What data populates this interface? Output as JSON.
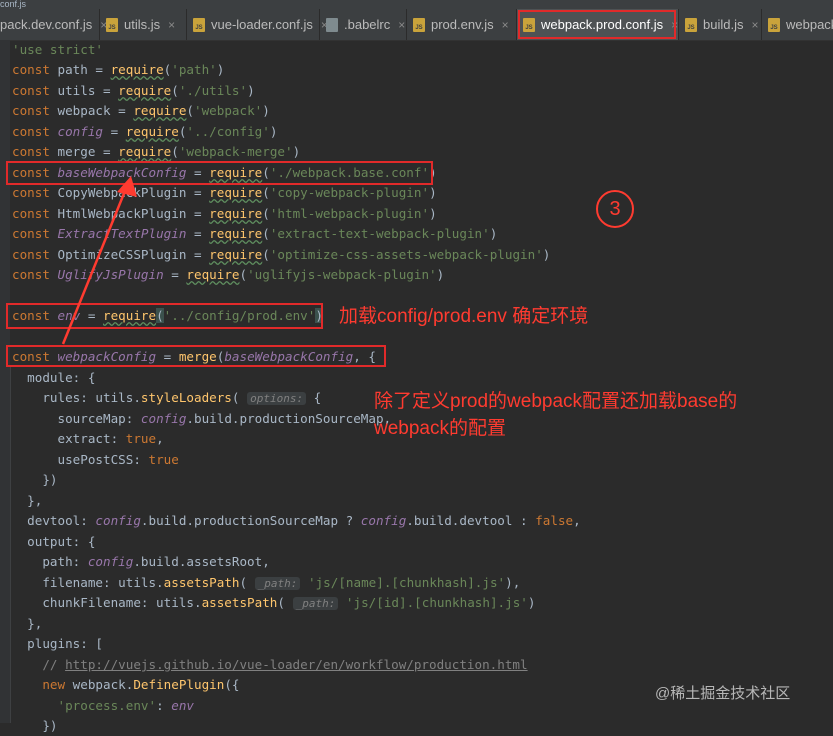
{
  "breadcrumb": "conf.js",
  "tabs": [
    {
      "label": "pack.dev.conf.js",
      "active": false
    },
    {
      "label": "utils.js",
      "active": false
    },
    {
      "label": "vue-loader.conf.js",
      "active": false
    },
    {
      "label": ".babelrc",
      "active": false
    },
    {
      "label": "prod.env.js",
      "active": false
    },
    {
      "label": "webpack.prod.conf.js",
      "active": true
    },
    {
      "label": "build.js",
      "active": false
    },
    {
      "label": "webpack",
      "active": false
    }
  ],
  "code": {
    "l1": {
      "s": "'use strict'"
    },
    "l2": {
      "kw": "const ",
      "id": "path",
      "eq": " = ",
      "fn": "require",
      "p1": "(",
      "s": "'path'",
      "p2": ")"
    },
    "l3": {
      "kw": "const ",
      "id": "utils",
      "eq": " = ",
      "fn": "require",
      "p1": "(",
      "s": "'./utils'",
      "p2": ")"
    },
    "l4": {
      "kw": "const ",
      "id": "webpack",
      "eq": " = ",
      "fn": "require",
      "p1": "(",
      "s": "'webpack'",
      "p2": ")"
    },
    "l5": {
      "kw": "const ",
      "id": "config",
      "eq": " = ",
      "fn": "require",
      "p1": "(",
      "s": "'../config'",
      "p2": ")"
    },
    "l6": {
      "kw": "const ",
      "id": "merge",
      "eq": " = ",
      "fn": "require",
      "p1": "(",
      "s": "'webpack-merge'",
      "p2": ")"
    },
    "l7": {
      "kw": "const ",
      "id": "baseWebpackConfig",
      "eq": " = ",
      "fn": "require",
      "p1": "(",
      "s": "'./webpack.base.conf'",
      "p2": ")"
    },
    "l8": {
      "kw": "const ",
      "id": "CopyWebpackPlugin",
      "eq": " = ",
      "fn": "require",
      "p1": "(",
      "s": "'copy-webpack-plugin'",
      "p2": ")"
    },
    "l9": {
      "kw": "const ",
      "id": "HtmlWebpackPlugin",
      "eq": " = ",
      "fn": "require",
      "p1": "(",
      "s": "'html-webpack-plugin'",
      "p2": ")"
    },
    "l10": {
      "kw": "const ",
      "id": "ExtractTextPlugin",
      "eq": " = ",
      "fn": "require",
      "p1": "(",
      "s": "'extract-text-webpack-plugin'",
      "p2": ")"
    },
    "l11": {
      "kw": "const ",
      "id": "OptimizeCSSPlugin",
      "eq": " = ",
      "fn": "require",
      "p1": "(",
      "s": "'optimize-css-assets-webpack-plugin'",
      "p2": ")"
    },
    "l12": {
      "kw": "const ",
      "id": "UglifyJsPlugin",
      "eq": " = ",
      "fn": "require",
      "p1": "(",
      "s": "'uglifyjs-webpack-plugin'",
      "p2": ")"
    },
    "l14": {
      "kw": "const ",
      "id": "env",
      "eq": " = ",
      "fn": "require",
      "p1": "(",
      "s": "'../config/prod.env'",
      "p2": ")"
    },
    "l16": {
      "kw": "const ",
      "id": "webpackConfig",
      "eq": " = ",
      "fn": "merge",
      "p1": "(",
      "arg": "baseWebpackConfig",
      "p2": ", {"
    },
    "l17": {
      "a": "  module: {"
    },
    "l18": {
      "a": "    rules: utils.",
      "fn": "styleLoaders",
      "b": "(",
      "hint": "options:",
      "c": " {"
    },
    "l19": {
      "a": "      sourceMap: ",
      "it": "config",
      "b": ".build.productionSourceMap,"
    },
    "l20": {
      "a": "      extract: ",
      "kw": "true",
      "b": ","
    },
    "l21": {
      "a": "      usePostCSS: ",
      "kw": "true"
    },
    "l22": {
      "a": "    })"
    },
    "l23": {
      "a": "  },"
    },
    "l24": {
      "a": "  devtool: ",
      "it1": "config",
      "b": ".build.productionSourceMap ? ",
      "it2": "config",
      "c": ".build.devtool : ",
      "kw": "false",
      "d": ","
    },
    "l25": {
      "a": "  output: {"
    },
    "l26": {
      "a": "    path: ",
      "it": "config",
      "b": ".build.assetsRoot,"
    },
    "l27": {
      "a": "    filename: utils.",
      "fn": "assetsPath",
      "b": "(",
      "hint": "_path:",
      "s": " 'js/[name].[chunkhash].js'",
      "c": "),"
    },
    "l28": {
      "a": "    chunkFilename: utils.",
      "fn": "assetsPath",
      "b": "(",
      "hint": "_path:",
      "s": " 'js/[id].[chunkhash].js'",
      "c": ")"
    },
    "l29": {
      "a": "  },"
    },
    "l30": {
      "a": "  plugins: ["
    },
    "l31": {
      "c": "    // ",
      "lnk": "http://vuejs.github.io/vue-loader/en/workflow/production.html"
    },
    "l32": {
      "kw": "    new ",
      "a": "webpack.",
      "fn": "DefinePlugin",
      "b": "({"
    },
    "l33": {
      "s": "      'process.env'",
      "a": ": ",
      "it": "env"
    },
    "l34": {
      "a": "    })"
    }
  },
  "annotations": {
    "circle": "3",
    "env_note": "加载config/prod.env 确定环境",
    "merge_note_1": "除了定义prod的webpack配置还加载base的",
    "merge_note_2": "webpack的配置"
  },
  "watermark": "@稀土掘金技术社区",
  "colors": {
    "highlight": "#e12a2a",
    "keyword": "#cc7832",
    "string": "#6a8759",
    "function": "#ffc66d"
  }
}
